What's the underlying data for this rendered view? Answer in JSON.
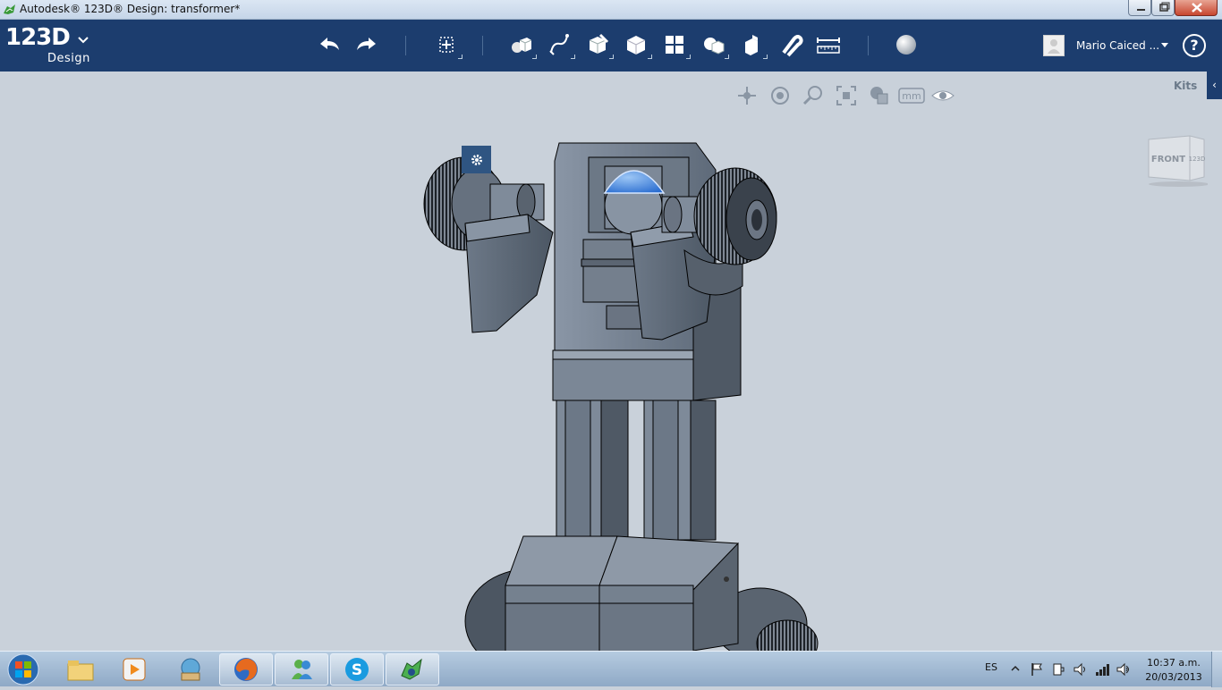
{
  "window": {
    "title": "Autodesk® 123D® Design: transformer*"
  },
  "logo": {
    "main": "123D",
    "sub": "Design"
  },
  "toolbar": {
    "tools": [
      {
        "name": "undo-icon"
      },
      {
        "name": "redo-icon"
      },
      {
        "name": "transform-icon"
      },
      {
        "name": "primitives-icon"
      },
      {
        "name": "sketch-icon"
      },
      {
        "name": "construct-icon"
      },
      {
        "name": "modify-icon"
      },
      {
        "name": "pattern-icon"
      },
      {
        "name": "grouping-icon"
      },
      {
        "name": "combine-icon"
      },
      {
        "name": "snap-icon"
      },
      {
        "name": "measure-icon"
      },
      {
        "name": "material-icon"
      }
    ]
  },
  "user": {
    "name": "Mario Caiced ..."
  },
  "help": {
    "label": "?"
  },
  "viewport": {
    "units": "mm",
    "kits_label": "Kits",
    "kits_tab": "‹",
    "viewcube_front": "FRONT",
    "viewcube_right": "123D"
  },
  "taskbar": {
    "language": "ES",
    "time": "10:37 a.m.",
    "date": "20/03/2013",
    "apps": [
      "windows-explorer",
      "media-player",
      "internet-explorer-icon",
      "firefox",
      "messenger",
      "skype",
      "123d-design"
    ]
  },
  "colors": {
    "toolbar": "#1c3d6e",
    "viewport": "#c9d1da",
    "accent": "#2f5582",
    "highlight": "#3b7fd6"
  }
}
